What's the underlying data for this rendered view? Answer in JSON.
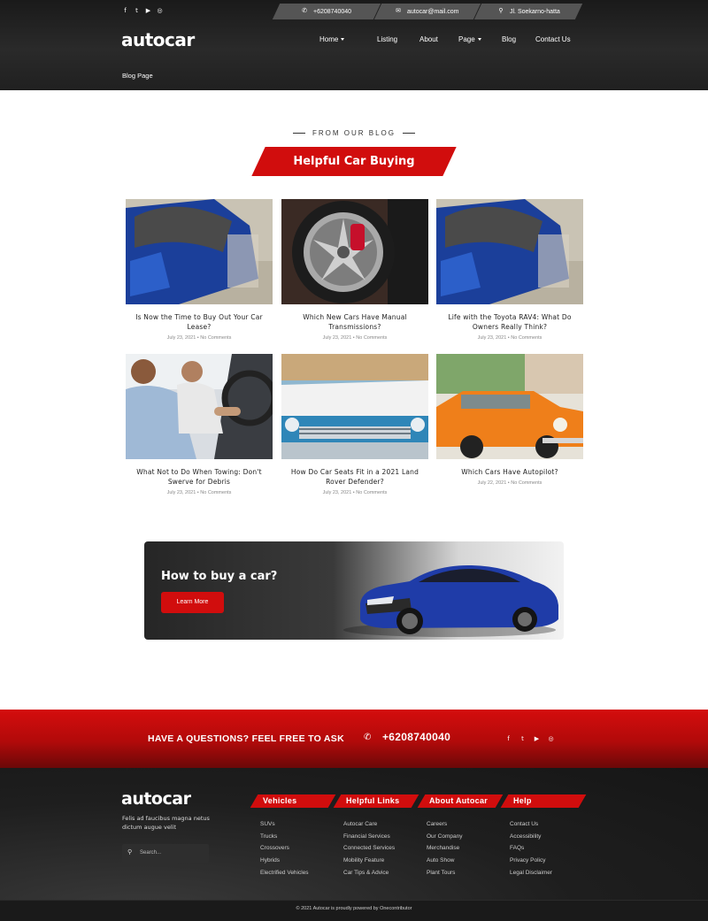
{
  "brand": {
    "logo_text": "autocar"
  },
  "topbar": {
    "social": [
      "f",
      "t",
      "▶",
      "◎"
    ],
    "phone": "+6208740040",
    "email": "autocar@mail.com",
    "address": "Jl. Soekarno-hatta"
  },
  "nav": {
    "items": [
      {
        "label": "Home",
        "has_dropdown": true
      },
      {
        "label": "Listing",
        "has_dropdown": false
      },
      {
        "label": "About",
        "has_dropdown": false
      },
      {
        "label": "Page",
        "has_dropdown": true
      },
      {
        "label": "Blog",
        "has_dropdown": false
      },
      {
        "label": "Contact Us",
        "has_dropdown": false
      }
    ]
  },
  "breadcrumb": {
    "current": "Blog Page"
  },
  "section": {
    "kicker": "FROM OUR BLOG",
    "title": "Helpful Car Buying"
  },
  "posts": [
    {
      "title_line1": "Is Now the Time to Buy Out Your Car",
      "title_line2": "Lease?",
      "meta": "July 23, 2021 • No Comments",
      "image": "blue-convertible"
    },
    {
      "title_line1": "Which New Cars Have Manual",
      "title_line2": "Transmissions?",
      "meta": "July 23, 2021 • No Comments",
      "image": "alloy-wheel-red-caliper"
    },
    {
      "title_line1": "Life with the Toyota RAV4: What Do",
      "title_line2": "Owners Really Think?",
      "meta": "July 23, 2021 • No Comments",
      "image": "blue-convertible"
    },
    {
      "title_line1": "What Not to Do When Towing: Don't",
      "title_line2": "Swerve for Debris",
      "meta": "July 23, 2021 • No Comments",
      "image": "couple-driving"
    },
    {
      "title_line1": "How Do Car Seats Fit in a 2021 Land",
      "title_line2": "Rover Defender?",
      "meta": "July 23, 2021 • No Comments",
      "image": "classic-blue-car"
    },
    {
      "title_line1": "Which Cars Have Autopilot?",
      "title_line2": "",
      "meta": "July 22, 2021 • No Comments",
      "image": "orange-classic-taxi"
    }
  ],
  "promo": {
    "title": "How to buy a car?",
    "button": "Learn More",
    "image": "blue-audi-sedan"
  },
  "cta": {
    "text": "HAVE A QUESTIONS? FEEL FREE TO ASK",
    "phone": "+6208740040",
    "social": [
      "f",
      "t",
      "▶",
      "◎"
    ]
  },
  "footer": {
    "logo_text": "autocar",
    "description": "Felis ad faucibus magna netus dictum augue velit",
    "search_placeholder": "Search...",
    "columns": [
      {
        "heading": "Vehicles",
        "links": [
          "SUVs",
          "Trucks",
          "Crossovers",
          "Hybrids",
          "Electrified Vehicles"
        ]
      },
      {
        "heading": "Helpful Links",
        "links": [
          "Autocar Care",
          "Financial Services",
          "Connected Services",
          "Mobility Feature",
          "Car Tips & Advice"
        ]
      },
      {
        "heading": "About Autocar",
        "links": [
          "Careers",
          "Our Company",
          "Merchandise",
          "Auto Show",
          "Plant Tours"
        ]
      },
      {
        "heading": "Help",
        "links": [
          "Contact Us",
          "Accessibility",
          "FAQs",
          "Privacy Policy",
          "Legal Disclaimer"
        ]
      }
    ],
    "copyright": "© 2021 Autocar is proudly powered by Onecontributor"
  },
  "colors": {
    "accent": "#d10d0d",
    "dark": "#1c1c1c"
  }
}
